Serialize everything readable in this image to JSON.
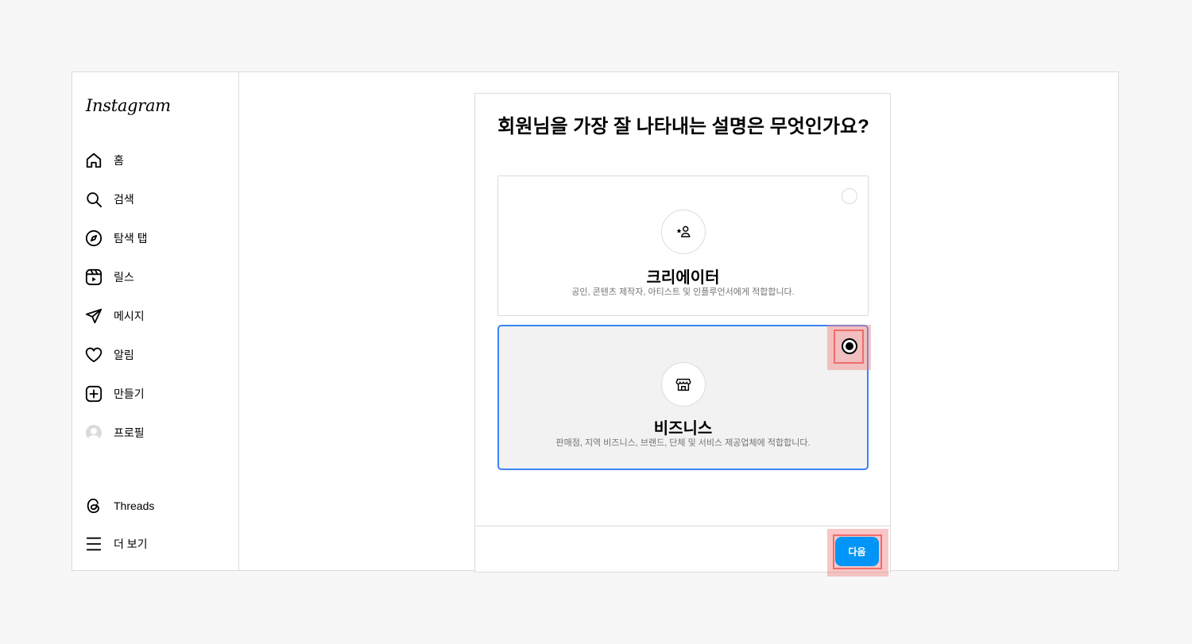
{
  "app": {
    "logo": "Instagram"
  },
  "sidebar": {
    "items": [
      {
        "label": "홈",
        "icon": "home-icon"
      },
      {
        "label": "검색",
        "icon": "search-icon"
      },
      {
        "label": "탐색 탭",
        "icon": "compass-icon"
      },
      {
        "label": "릴스",
        "icon": "reels-icon"
      },
      {
        "label": "메시지",
        "icon": "send-icon"
      },
      {
        "label": "알림",
        "icon": "heart-icon"
      },
      {
        "label": "만들기",
        "icon": "plus-square-icon"
      },
      {
        "label": "프로필",
        "icon": "avatar"
      }
    ],
    "bottom": [
      {
        "label": "Threads",
        "icon": "threads-icon"
      },
      {
        "label": "더 보기",
        "icon": "menu-icon"
      }
    ]
  },
  "dialog": {
    "title": "회원님을 가장 잘 나타내는 설명은 무엇인가요?",
    "options": [
      {
        "title": "크리에이터",
        "description": "공인, 콘텐츠 제작자, 아티스트 및 인플루언서에게 적합합니다.",
        "icon": "creator-icon",
        "selected": false
      },
      {
        "title": "비즈니스",
        "description": "판매점, 지역 비즈니스, 브랜드, 단체 및 서비스 제공업체에 적합합니다.",
        "icon": "shop-icon",
        "selected": true
      }
    ],
    "next_label": "다음"
  },
  "colors": {
    "accent": "#0095f6",
    "selected_border": "#3b82f6",
    "highlight": "#ef6b6b"
  }
}
